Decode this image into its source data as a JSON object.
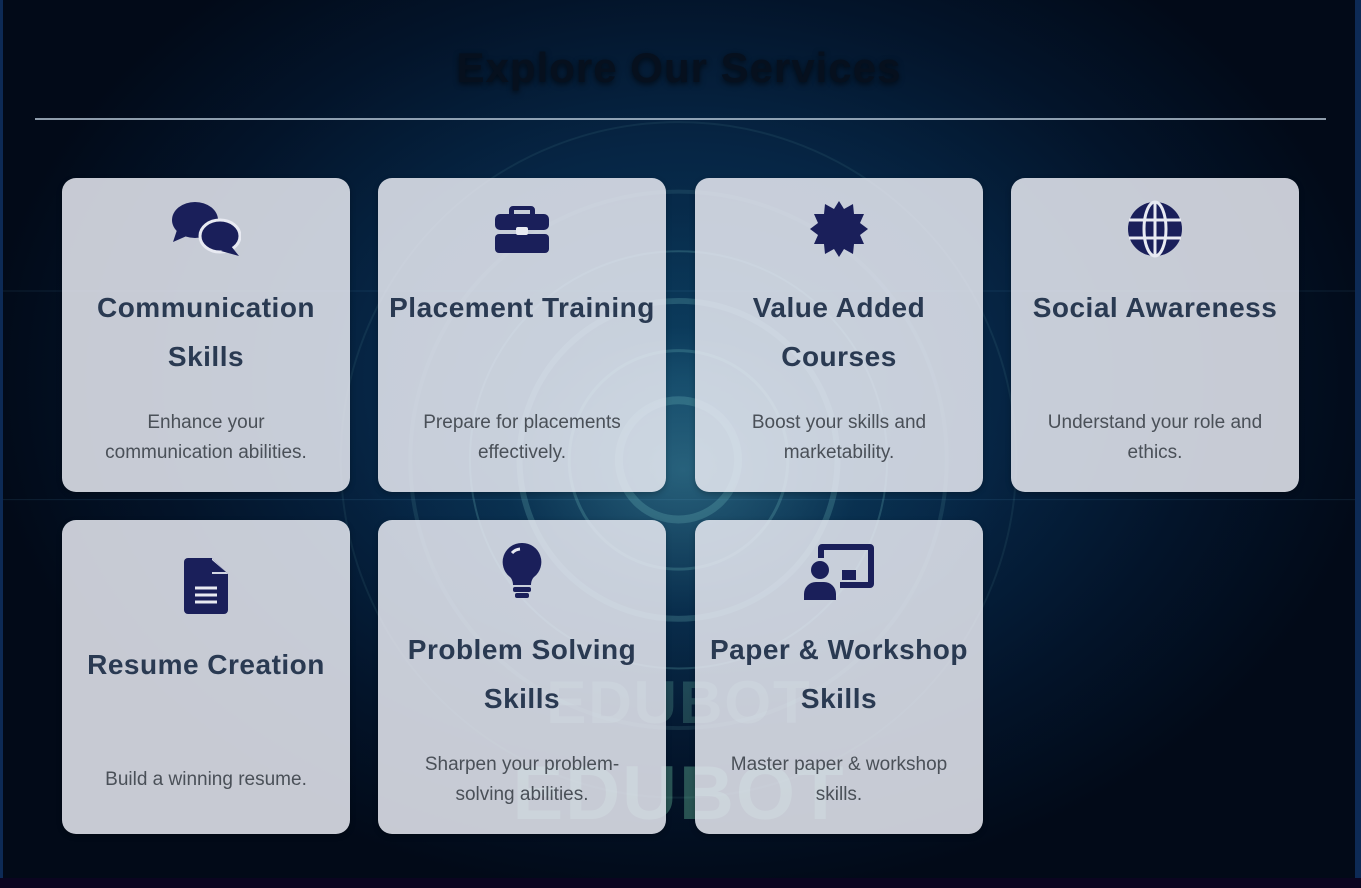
{
  "header": {
    "title": "Explore Our Services"
  },
  "watermark": {
    "text": "EDUBOT"
  },
  "services": [
    {
      "title": "Communication Skills",
      "description": "Enhance your communication abilities.",
      "icon": "comments-icon"
    },
    {
      "title": "Placement Training",
      "description": "Prepare for placements effectively.",
      "icon": "briefcase-icon"
    },
    {
      "title": "Value Added Courses",
      "description": "Boost your skills and marketability.",
      "icon": "certificate-icon"
    },
    {
      "title": "Social Awareness",
      "description": "Understand your role and ethics.",
      "icon": "globe-icon"
    },
    {
      "title": "Resume Creation",
      "description": "Build a winning resume.",
      "icon": "file-icon"
    },
    {
      "title": "Problem Solving Skills",
      "description": "Sharpen your problem-solving abilities.",
      "icon": "lightbulb-icon"
    },
    {
      "title": "Paper & Workshop Skills",
      "description": "Master paper & workshop skills.",
      "icon": "presentation-icon"
    }
  ],
  "colors": {
    "icon": "#1a1f5a",
    "card_title": "#2a3a52",
    "card_bg": "#e8eaf2"
  }
}
